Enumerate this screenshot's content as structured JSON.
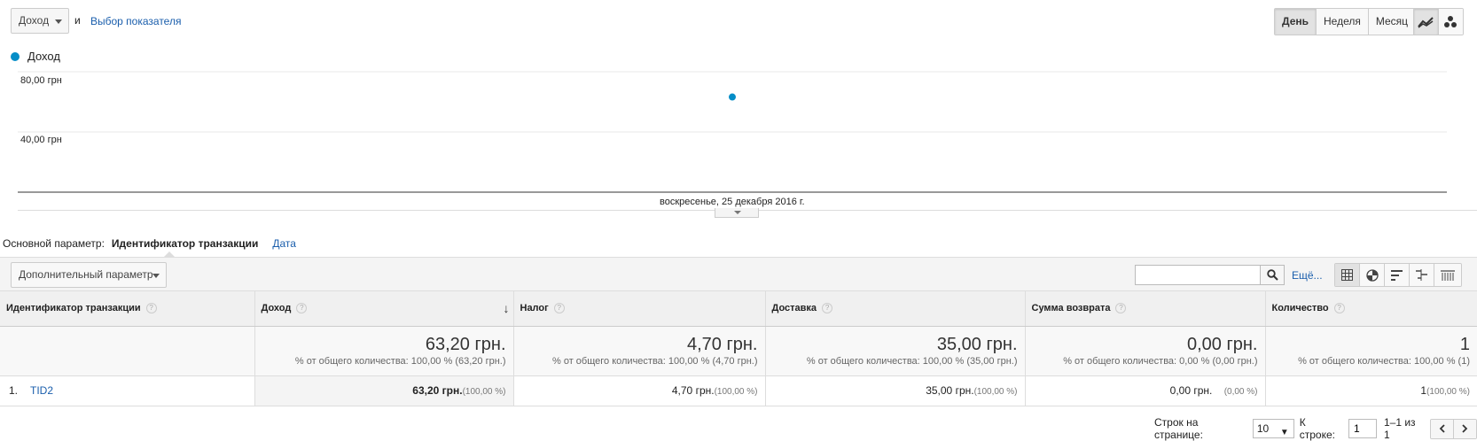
{
  "top": {
    "metric_select": "Доход",
    "and_text": "и",
    "metric_link": "Выбор показателя",
    "period_buttons": [
      "День",
      "Неделя",
      "Месяц"
    ],
    "active_period": "День"
  },
  "chart_data": {
    "type": "scatter",
    "series": [
      {
        "name": "Доход",
        "color": "#058dc7",
        "values": [
          63.2
        ]
      }
    ],
    "x": [
      "воскресенье, 25 декабря 2016 г."
    ],
    "y_ticks": [
      "80,00 грн",
      "40,00 грн"
    ],
    "y_tick_values": [
      80,
      40
    ],
    "ylim": [
      0,
      80
    ],
    "grid": true
  },
  "primary_dimension": {
    "label": "Основной параметр:",
    "active": "Идентификатор транзакции",
    "other": "Дата"
  },
  "toolbar": {
    "secondary_dim": "Дополнительный параметр",
    "search_placeholder": "",
    "more_link": "Ещё..."
  },
  "table": {
    "columns": [
      "Идентификатор транзакции",
      "Доход",
      "Налог",
      "Доставка",
      "Сумма возврата",
      "Количество"
    ],
    "help_glyph": "?",
    "sort_glyph": "↓",
    "totals": [
      {
        "value": "63,20 грн.",
        "pct": "% от общего количества: 100,00 % (63,20 грн.)"
      },
      {
        "value": "4,70 грн.",
        "pct": "% от общего количества: 100,00 % (4,70 грн.)"
      },
      {
        "value": "35,00 грн.",
        "pct": "% от общего количества: 100,00 % (35,00 грн.)"
      },
      {
        "value": "0,00 грн.",
        "pct": "% от общего количества: 0,00 % (0,00 грн.)"
      },
      {
        "value": "1",
        "pct": "% от общего количества: 100,00 % (1)"
      }
    ],
    "rows": [
      {
        "index": "1.",
        "id": "TID2",
        "cells": [
          {
            "value": "63,20 грн.",
            "pct": "(100,00 %)"
          },
          {
            "value": "4,70 грн.",
            "pct": "(100,00 %)"
          },
          {
            "value": "35,00 грн.",
            "pct": "(100,00 %)"
          },
          {
            "value": "0,00 грн.",
            "pct": "(0,00 %)"
          },
          {
            "value": "1",
            "pct": "(100,00 %)"
          }
        ]
      }
    ]
  },
  "pagination": {
    "rows_label": "Строк на странице:",
    "rows_value": "10",
    "goto_label": "К строке:",
    "goto_value": "1",
    "range": "1–1 из 1"
  }
}
